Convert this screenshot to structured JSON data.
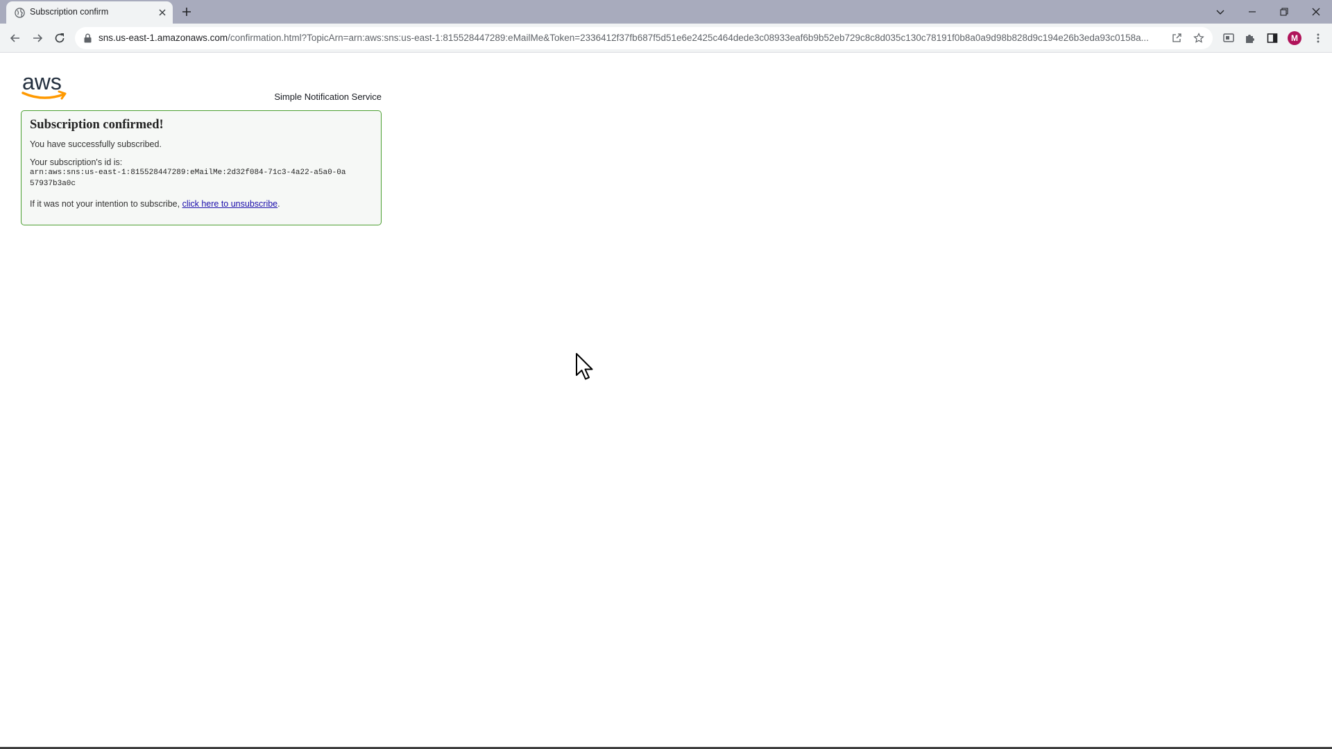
{
  "browser": {
    "tab": {
      "title": "Subscription confirm"
    },
    "address": {
      "host": "sns.us-east-1.amazonaws.com",
      "path": "/confirmation.html?TopicArn=arn:aws:sns:us-east-1:815528447289:eMailMe&Token=2336412f37fb687f5d51e6e2425c464dede3c08933eaf6b9b52eb729c8c8d035c130c78191f0b8a0a9d98b828d9c194e26b3eda93c0158a..."
    },
    "profile": {
      "initial": "M",
      "color": "#b0135a"
    }
  },
  "page": {
    "service_name": "Simple Notification Service",
    "confirmation": {
      "title": "Subscription confirmed!",
      "success_text": "You have successfully subscribed.",
      "id_label": "Your subscription's id is:",
      "subscription_id": "arn:aws:sns:us-east-1:815528447289:eMailMe:2d32f084-71c3-4a22-a5a0-0a57937b3a0c",
      "unsubscribe_prefix": "If it was not your intention to subscribe, ",
      "unsubscribe_link": "click here to unsubscribe",
      "unsubscribe_suffix": "."
    },
    "colors": {
      "box_border": "#4a9e2f",
      "box_background": "#f6f8f6",
      "link": "#1a0dab",
      "aws_smile": "#ff9900"
    }
  }
}
